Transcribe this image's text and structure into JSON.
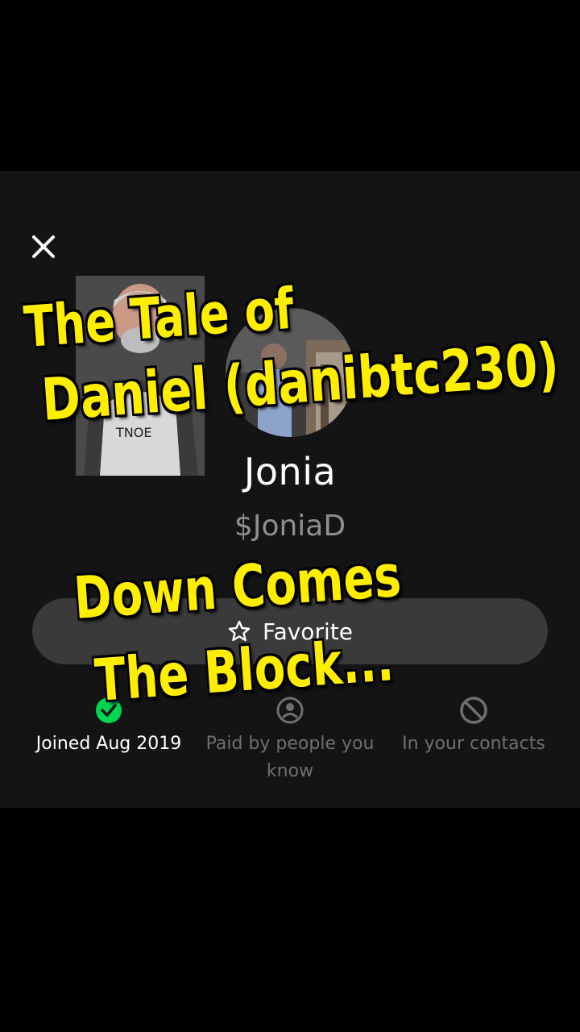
{
  "profile": {
    "name": "Jonia",
    "handle": "$JoniaD"
  },
  "actions": {
    "close_icon": "close-icon",
    "favorite_label": "Favorite",
    "favorite_icon": "star-outline-icon"
  },
  "info": {
    "joined": "Joined Aug 2019",
    "paid": "Paid by people you know",
    "contacts": "In your contacts",
    "joined_icon": "check-circle-icon",
    "paid_icon": "people-circle-icon",
    "contacts_icon": "block-icon"
  },
  "overlay": {
    "line1": "The Tale of",
    "line2": "Daniel (danibtc230)",
    "line3": "Down Comes",
    "line4": "The Block..."
  },
  "colors": {
    "background": "#000000",
    "panel": "#141414",
    "button": "#3a3a3a",
    "overlay_text": "#ffee00",
    "accent_green": "#00d64f"
  }
}
